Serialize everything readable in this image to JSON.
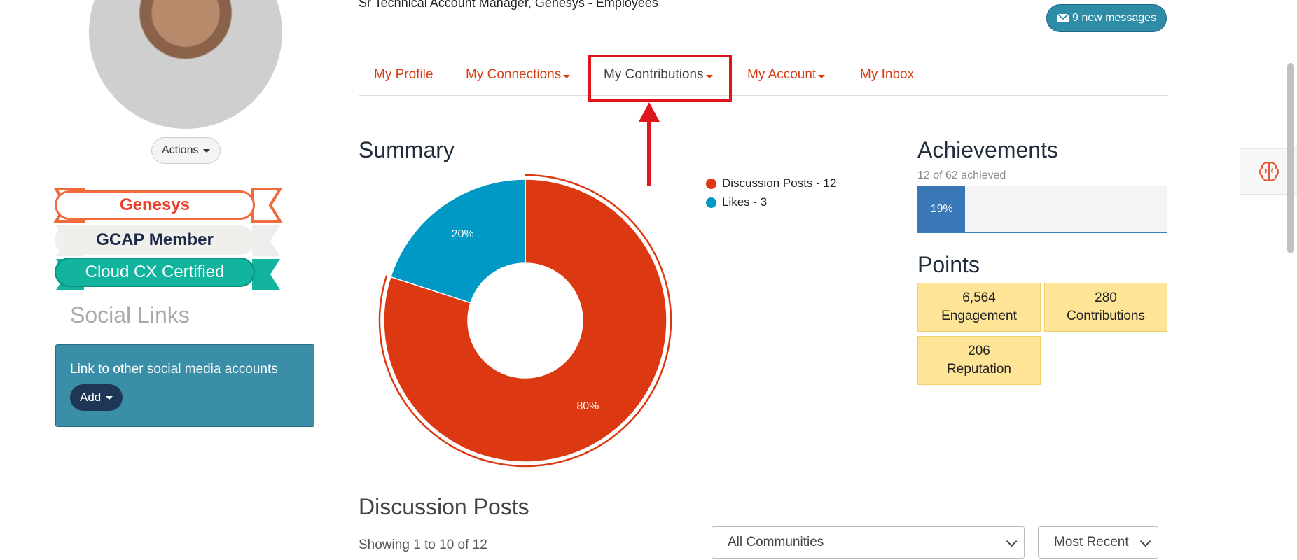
{
  "header": {
    "subtitle": "Sr Technical Account Manager, Genesys - Employees",
    "messages_label": "9 new messages"
  },
  "profile": {
    "actions_label": "Actions",
    "badges": [
      {
        "label": "Genesys",
        "color": "#e8412e"
      },
      {
        "label": "GCAP Member",
        "color": "#1c2a4a"
      },
      {
        "label": "Cloud CX Certified",
        "color": "#ffffff"
      }
    ]
  },
  "social": {
    "title": "Social Links",
    "description": "Link to other social media accounts",
    "add_label": "Add"
  },
  "nav": {
    "items": [
      {
        "label": "My Profile",
        "dropdown": false
      },
      {
        "label": "My Connections",
        "dropdown": true
      },
      {
        "label": "My Contributions",
        "dropdown": true,
        "active": true
      },
      {
        "label": "My Account",
        "dropdown": true
      },
      {
        "label": "My Inbox",
        "dropdown": false
      }
    ]
  },
  "summary": {
    "title": "Summary"
  },
  "chart_data": {
    "type": "pie",
    "donut": true,
    "categories": [
      "Discussion Posts",
      "Likes"
    ],
    "values": [
      12,
      3
    ],
    "percent_labels": [
      "80%",
      "20%"
    ],
    "legend_labels": [
      "Discussion Posts - 12",
      "Likes - 3"
    ],
    "colors": [
      "#dc3912",
      "#0099c6"
    ],
    "legend_position": "right"
  },
  "achievements": {
    "title": "Achievements",
    "subtitle": "12 of 62 achieved",
    "progress_percent": 19,
    "progress_label": "19%"
  },
  "points": {
    "title": "Points",
    "items": [
      {
        "value": "6,564",
        "label": "Engagement"
      },
      {
        "value": "280",
        "label": "Contributions"
      },
      {
        "value": "206",
        "label": "Reputation"
      }
    ]
  },
  "discussion": {
    "title": "Discussion Posts",
    "showing": "Showing 1 to 10 of 12",
    "community_filter": "All Communities",
    "sort_filter": "Most Recent"
  },
  "colors": {
    "accent": "#d43d14",
    "highlight": "#e0141d",
    "message_button": "#2f8ca6",
    "social_box": "#3b8ea8",
    "points_box": "#fde497"
  }
}
